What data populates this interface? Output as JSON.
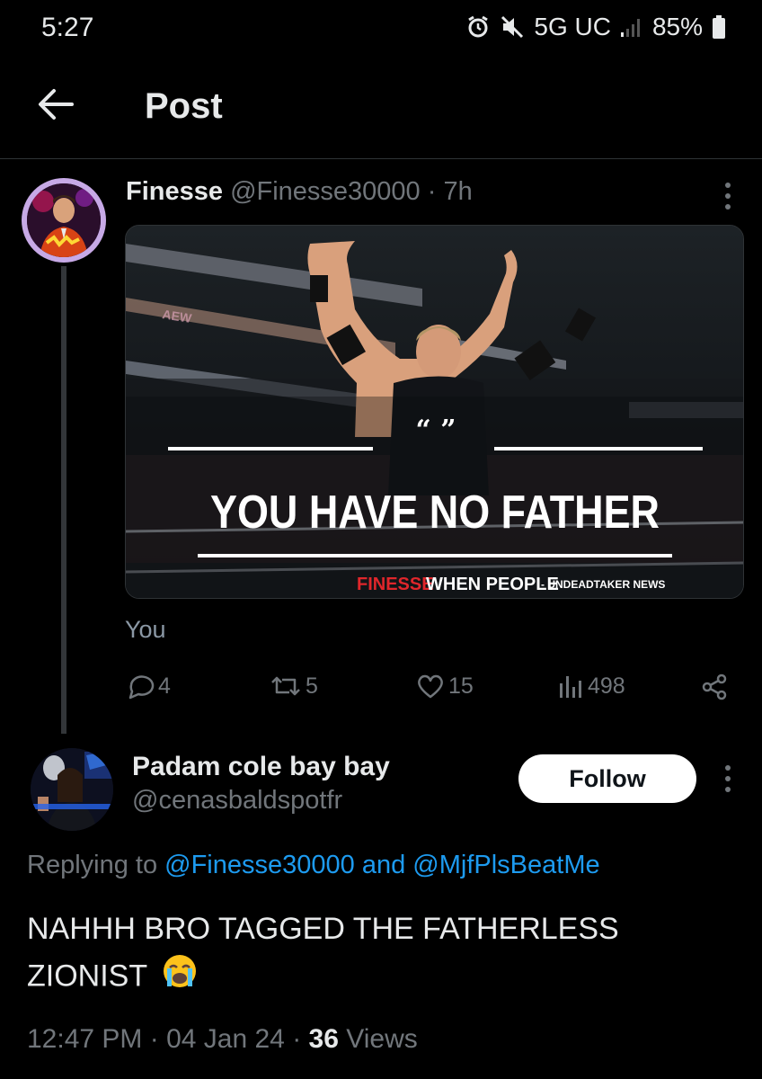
{
  "status_bar": {
    "time": "5:27",
    "network": "5G UC",
    "battery": "85%"
  },
  "header": {
    "title": "Post"
  },
  "post": {
    "author_name": "Finesse",
    "author_handle": "@Finesse30000",
    "separator": "·",
    "age": "7h",
    "image": {
      "quote_marks": "“ ”",
      "headline": "YOU HAVE NO FATHER",
      "caption_red": "FINESSE",
      "caption_white": "WHEN PEOPLE",
      "caption_credit": "- UNDEADTAKER NEWS",
      "arena_banner": "AEW"
    },
    "text": "You",
    "replies": "4",
    "reposts": "5",
    "likes": "15",
    "views": "498"
  },
  "reply": {
    "author_name": "Padam cole bay bay",
    "author_handle": "@cenasbaldspotfr",
    "follow_label": "Follow",
    "replying_prefix": "Replying to",
    "mention1": "@Finesse30000",
    "and": "and",
    "mention2": "@MjfPlsBeatMe",
    "text": "NAHHH BRO TAGGED THE FATHERLESS ZIONIST",
    "emoji": "😭",
    "time": "12:47 PM",
    "date": "04 Jan 24",
    "views_count": "36",
    "views_label": "Views"
  },
  "colors": {
    "background": "#000000",
    "text_primary": "#e7e9ea",
    "text_secondary": "#71767b",
    "link": "#1d9bf0",
    "caption_red": "#e0262b"
  },
  "icons": [
    "back-arrow-icon",
    "alarm-icon",
    "mute-icon",
    "signal-icon",
    "battery-icon",
    "more-icon",
    "reply-icon",
    "repost-icon",
    "like-icon",
    "views-icon",
    "share-icon",
    "emoji-crying-icon"
  ]
}
